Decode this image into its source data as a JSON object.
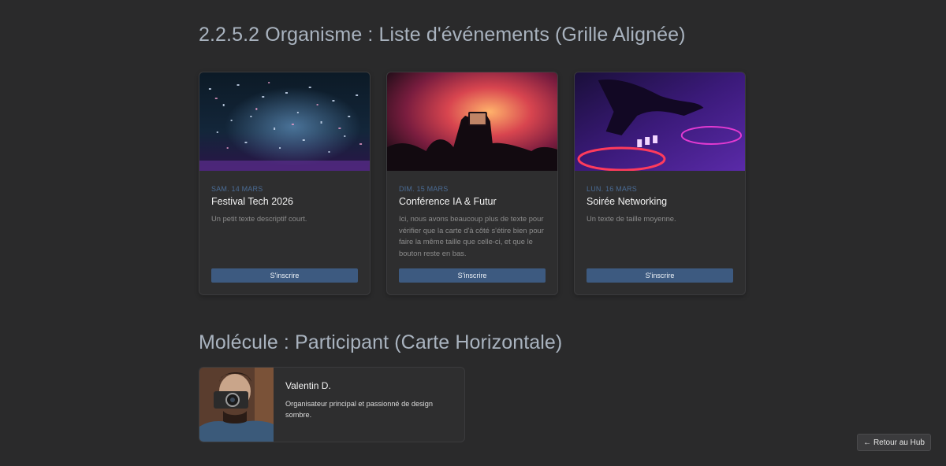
{
  "sections": {
    "events_title": "2.2.5.2 Organisme : Liste d'événements (Grille Alignée)",
    "participant_title": "Molécule : Participant (Carte Horizontale)"
  },
  "events": [
    {
      "date": "SAM. 14 MARS",
      "title": "Festival Tech 2026",
      "description": "Un petit texte descriptif court.",
      "button": "S'inscrire",
      "image": "confetti-concert-photo"
    },
    {
      "date": "DIM. 15 MARS",
      "title": "Conférence IA & Futur",
      "description": "Ici, nous avons beaucoup plus de texte pour vérifier que la carte d'à côté s'étire bien pour faire la même taille que celle-ci, et que le bouton reste en bas.",
      "button": "S'inscrire",
      "image": "concert-phone-photo"
    },
    {
      "date": "LUN. 16 MARS",
      "title": "Soirée Networking",
      "description": "Un texte de taille moyenne.",
      "button": "S'inscrire",
      "image": "dj-turntable-photo"
    }
  ],
  "participant": {
    "name": "Valentin D.",
    "bio": "Organisateur principal et passionné de design sombre.",
    "image": "photographer-camera-photo"
  },
  "hub_button": "← Retour au Hub",
  "colors": {
    "background": "#2a2a2b",
    "card": "#2e2e2f",
    "accent": "#3d5a80",
    "date": "#4a6b94",
    "heading": "#a9b3bf"
  }
}
